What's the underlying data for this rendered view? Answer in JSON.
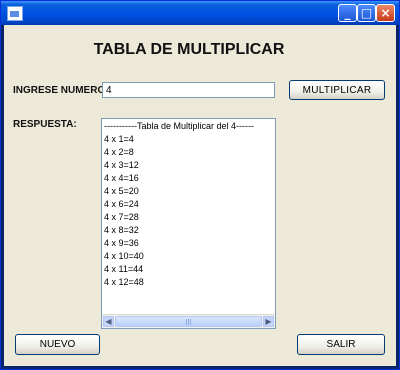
{
  "window": {
    "title": "",
    "controls": {
      "minimize": "_",
      "maximize": "□",
      "close": "×"
    }
  },
  "form": {
    "heading": "TABLA DE MULTIPLICAR",
    "number_label": "INGRESE NUMERO:",
    "number_value": "4",
    "multiply_button": "MULTIPLICAR",
    "answer_label": "RESPUESTA:",
    "new_button": "NUEVO",
    "exit_button": "SALIR"
  },
  "results": {
    "lines": [
      "-----------Tabla de Multiplicar del 4------",
      "4 x 1=4",
      "4 x 2=8",
      "4 x 3=12",
      "4 x 4=16",
      "4 x 5=20",
      "4 x 6=24",
      "4 x 7=28",
      "4 x 8=32",
      "4 x 9=36",
      "4 x 10=40",
      "4 x 11=44",
      "4 x 12=48"
    ],
    "scrollbar": {
      "left_arrow": "◀",
      "right_arrow": "▶"
    }
  }
}
